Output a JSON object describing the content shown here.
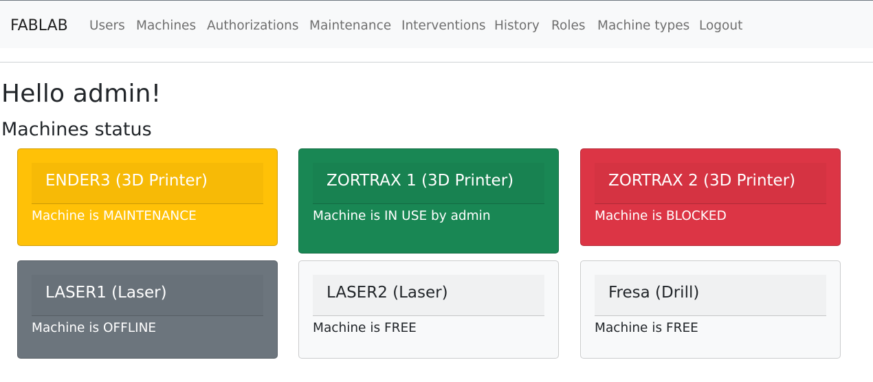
{
  "navbar": {
    "brand": "FABLAB",
    "items": [
      "Users",
      "Machines",
      "Authorizations",
      "Maintenance",
      "Interventions",
      "History",
      "Roles",
      "Machine types",
      "Logout"
    ]
  },
  "main": {
    "greeting": "Hello admin!",
    "section_title": "Machines status"
  },
  "machines": [
    {
      "title": "ENDER3 (3D Printer)",
      "status": "Machine is MAINTENANCE",
      "color": "#ffc107"
    },
    {
      "title": "ZORTRAX 1 (3D Printer)",
      "status": "Machine is IN USE by admin",
      "color": "#198754"
    },
    {
      "title": "ZORTRAX 2 (3D Printer)",
      "status": "Machine is BLOCKED",
      "color": "#dc3545"
    },
    {
      "title": "LASER1 (Laser)",
      "status": "Machine is OFFLINE",
      "color": "#6c757d"
    },
    {
      "title": "LASER2 (Laser)",
      "status": "Machine is FREE",
      "color": "#f8f9fa"
    },
    {
      "title": "Fresa (Drill)",
      "status": "Machine is FREE",
      "color": "#f8f9fa"
    }
  ]
}
